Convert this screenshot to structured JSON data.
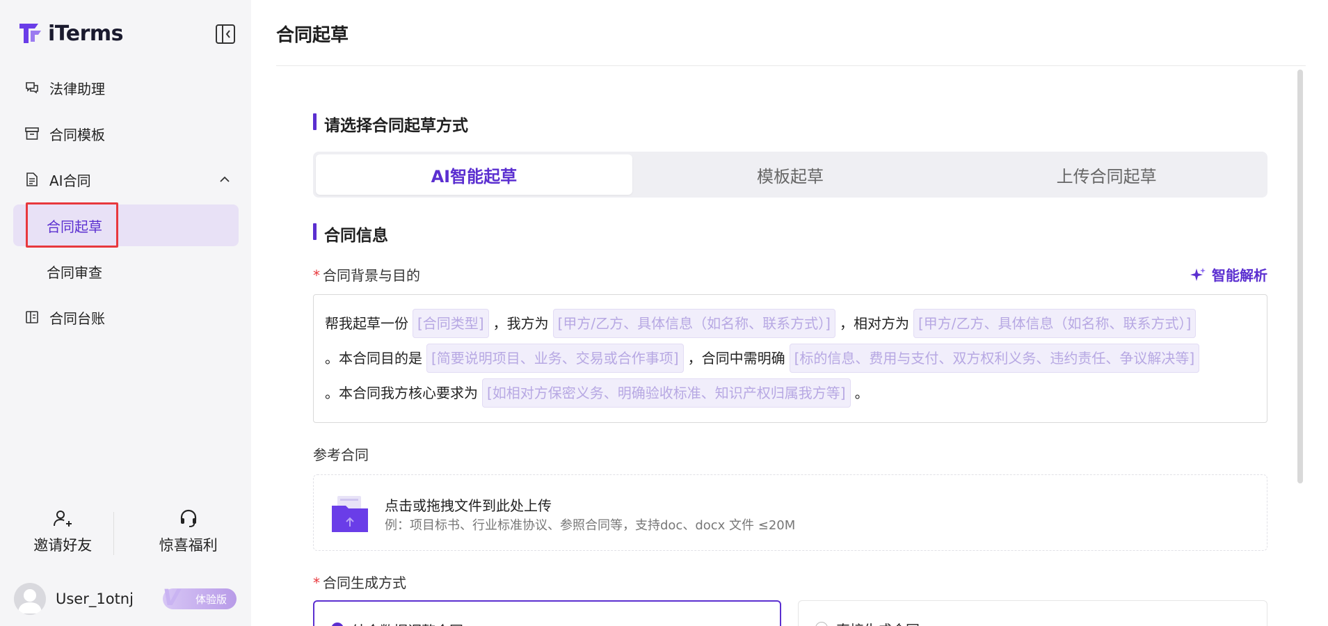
{
  "app": {
    "name": "iTerms"
  },
  "sidebar": {
    "items": [
      {
        "label": "法律助理",
        "icon": "chat-bubbles-icon"
      },
      {
        "label": "合同模板",
        "icon": "archive-box-icon"
      },
      {
        "label": "AI合同",
        "icon": "document-icon",
        "expanded": true
      },
      {
        "label": "合同起草",
        "sub": true,
        "active": true
      },
      {
        "label": "合同审查",
        "sub": true
      },
      {
        "label": "合同台账",
        "icon": "ledger-book-icon"
      }
    ],
    "invite_label": "邀请好友",
    "gift_label": "惊喜福利"
  },
  "user": {
    "name": "User_1otnj",
    "badge": "体验版"
  },
  "page": {
    "title": "合同起草"
  },
  "method": {
    "heading": "请选择合同起草方式",
    "tabs": [
      "AI智能起草",
      "模板起草",
      "上传合同起草"
    ],
    "active_tab": 0
  },
  "info": {
    "heading": "合同信息",
    "background_label": "合同背景与目的",
    "smart_parse_label": "智能解析",
    "prompt": {
      "t1": "帮我起草一份",
      "p1": "[合同类型]",
      "t2": "，我方为",
      "p2": "[甲方/乙方、具体信息（如名称、联系方式）]",
      "t3": "，相对方为",
      "p3": "[甲方/乙方、具体信息（如名称、联系方式）]",
      "t4": "。本合同目的是",
      "p4": "[简要说明项目、业务、交易或合作事项]",
      "t5": "，合同中需明确",
      "p5": "[标的信息、费用与支付、双方权利义务、违约责任、争议解决等]",
      "t6": "。本合同我方核心要求为",
      "p6": "[如相对方保密义务、明确验收标准、知识产权归属我方等]",
      "t7": "。"
    },
    "reference_label": "参考合同",
    "upload_main": "点击或拖拽文件到此处上传",
    "upload_sub": "例：项目标书、行业标准协议、参照合同等，支持doc、docx 文件 ≤20M",
    "generate_label": "合同生成方式",
    "options": [
      "结合数据调整合同",
      "直接生成合同"
    ]
  },
  "colors": {
    "accent": "#5b2fd0",
    "highlight_border": "#e8383d"
  }
}
